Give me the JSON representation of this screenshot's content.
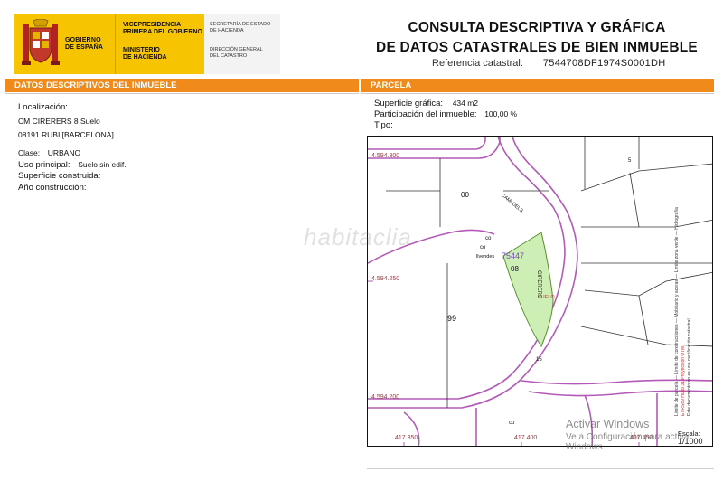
{
  "header": {
    "gov_name_line1": "GOBIERNO",
    "gov_name_line2": "DE ESPAÑA",
    "vice_line1": "VICEPRESIDENCIA",
    "vice_line2": "PRIMERA DEL GOBIERNO",
    "ministry_line1": "MINISTERIO",
    "ministry_line2": "DE HACIENDA",
    "secretaria_line1": "SECRETARÍA DE ESTADO",
    "secretaria_line2": "DE HACIENDA",
    "direccion_line1": "DIRECCIÓN GENERAL",
    "direccion_line2": "DEL CATASTRO",
    "title_line1": "CONSULTA DESCRIPTIVA Y GRÁFICA",
    "title_line2": "DE DATOS CATASTRALES DE BIEN INMUEBLE",
    "ref_label": "Referencia catastral:",
    "ref_value": "7544708DF1974S0001DH"
  },
  "left_section": {
    "bar_title": "DATOS DESCRIPTIVOS DEL INMUEBLE",
    "localizacion_label": "Localización:",
    "localizacion_line1": "CM CIRERERS 8 Suelo",
    "localizacion_line2": "08191 RUBI [BARCELONA]",
    "clase_label": "Clase:",
    "clase_value": "URBANO",
    "uso_label": "Uso principal:",
    "uso_value": "Suelo sin edif.",
    "superficie_label": "Superficie construida:",
    "anio_label": "Año construcción:"
  },
  "right_section": {
    "bar_title": "PARCELA",
    "superficie_label": "Superficie gráfica:",
    "superficie_value": "434 m2",
    "participacion_label": "Participación del inmueble:",
    "participacion_value": "100,00 %",
    "tipo_label": "Tipo:"
  },
  "map": {
    "coord_top_left": "4.594.300",
    "coord_mid_left": "4.594.250",
    "coord_bottom_left": "4.594.200",
    "coord_bottom_x1": "417.350",
    "coord_bottom_x2": "417.400",
    "coord_bottom_x3": "417.450",
    "label_00": "00",
    "label_co1": "co",
    "label_co2": "co",
    "label_vivendes": "llvendes",
    "parcel_ref": "75447",
    "parcel_num": "08",
    "label_99": "99",
    "label_suelo": "SUELO",
    "street_1": "CIRERERS",
    "street_2": "CAMI DELS",
    "label_5": "5",
    "label_15": "15",
    "label_co3": "co",
    "scale_label": "Escala:",
    "scale_value": "1/1000",
    "parcel_fill": "#cdeeb4",
    "parcel_stroke": "#5a8f2e",
    "road_color": "#b35ab8"
  },
  "side_legend": {
    "line1": "Límite de parcela",
    "line2": "Límite de construcciones",
    "line3": "Mobiliario y aceras",
    "line4": "Límite zona verde",
    "line5": "Hidrografía",
    "red_note": "ETRS89 Huso 31 Proyección UTM",
    "note": "Este documento no es una certificación catastral"
  },
  "watermark": {
    "brand": "habitaclia",
    "activate_line1": "Activar Windows",
    "activate_line2": "Ve a Configuración para activar Windows."
  },
  "colors": {
    "orange": "#f08a1a",
    "gov_yellow": "#f6c400"
  }
}
